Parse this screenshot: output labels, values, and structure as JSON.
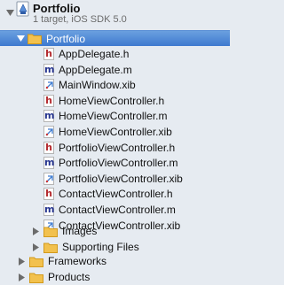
{
  "project": {
    "name": "Portfolio",
    "subtitle": "1 target, iOS SDK 5.0"
  },
  "group": {
    "name": "Portfolio"
  },
  "files": [
    {
      "name": "AppDelegate.h",
      "kind": "h"
    },
    {
      "name": "AppDelegate.m",
      "kind": "m"
    },
    {
      "name": "MainWindow.xib",
      "kind": "xib"
    },
    {
      "name": "HomeViewController.h",
      "kind": "h"
    },
    {
      "name": "HomeViewController.m",
      "kind": "m"
    },
    {
      "name": "HomeViewController.xib",
      "kind": "xib"
    },
    {
      "name": "PortfolioViewController.h",
      "kind": "h"
    },
    {
      "name": "PortfolioViewController.m",
      "kind": "m"
    },
    {
      "name": "PortfolioViewController.xib",
      "kind": "xib"
    },
    {
      "name": "ContactViewController.h",
      "kind": "h"
    },
    {
      "name": "ContactViewController.m",
      "kind": "m"
    },
    {
      "name": "ContactViewController.xib",
      "kind": "xib"
    }
  ],
  "subfolders": [
    {
      "name": "Images"
    },
    {
      "name": "Supporting Files"
    }
  ],
  "top_folders": [
    {
      "name": "Frameworks"
    },
    {
      "name": "Products"
    }
  ],
  "icons": {
    "h_glyph": "h",
    "m_glyph": "m"
  },
  "colors": {
    "sidebar_bg": "#e6ebf1",
    "selection": "#3e79cf",
    "folder": "#f2c14e",
    "h_icon": "#b3282d",
    "m_icon": "#26358f"
  }
}
